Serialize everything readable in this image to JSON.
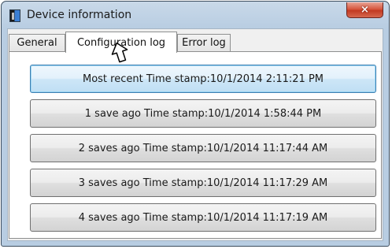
{
  "window": {
    "title": "Device information",
    "close_symbol": "×"
  },
  "tabs": [
    {
      "label": "General",
      "active": false
    },
    {
      "label": "Configuration log",
      "active": true
    },
    {
      "label": "Error log",
      "active": false
    }
  ],
  "log_entries": [
    "Most recent Time stamp:10/1/2014 2:11:21 PM",
    "1 save ago Time stamp:10/1/2014 1:58:44 PM",
    "2 saves ago Time stamp:10/1/2014 11:17:44 AM",
    "3 saves ago Time stamp:10/1/2014 11:17:29 AM",
    "4 saves ago Time stamp:10/1/2014 11:17:19 AM"
  ],
  "icons": {
    "app": "device-app-icon",
    "close": "close-icon",
    "cursor": "mouse-pointer-icon"
  },
  "colors": {
    "title_bar": "#b8cde2",
    "close_button": "#c23a22",
    "focused_button_border": "#3c7fb1"
  }
}
